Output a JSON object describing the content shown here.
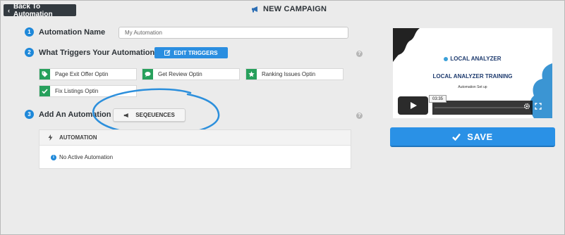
{
  "back_button": {
    "label": "Back To Automation"
  },
  "header": {
    "title": "NEW CAMPAIGN"
  },
  "steps": [
    {
      "number": "1",
      "label": "Automation Name"
    },
    {
      "number": "2",
      "label": "What Triggers Your Automation?"
    },
    {
      "number": "3",
      "label": "Add An Automation"
    }
  ],
  "automation_name": {
    "value": "My Automation"
  },
  "edit_triggers": {
    "label": "EDIT TRIGGERS"
  },
  "help": {
    "symbol": "?"
  },
  "triggers": [
    {
      "label": "Page Exit Offer Optin",
      "icon": "tag-icon"
    },
    {
      "label": "Get Review Optin",
      "icon": "comment-icon"
    },
    {
      "label": "Ranking Issues Optin",
      "icon": "star-icon"
    },
    {
      "label": "Fix Listings Optin",
      "icon": "check-icon"
    }
  ],
  "sequences_button": {
    "label": "SEQEUENCES"
  },
  "automation_panel": {
    "title": "AUTOMATION",
    "empty_message": "No Active Automation"
  },
  "video": {
    "brand": "LOCAL ANALYZER",
    "title": "LOCAL ANALYZER TRAINING",
    "subtitle": "Automation Set up",
    "timestamp": "03:35"
  },
  "save_button": {
    "label": "SAVE"
  },
  "colors": {
    "accent_blue": "#2a91e6",
    "trigger_green": "#27a05c",
    "dark_button": "#333a40"
  }
}
